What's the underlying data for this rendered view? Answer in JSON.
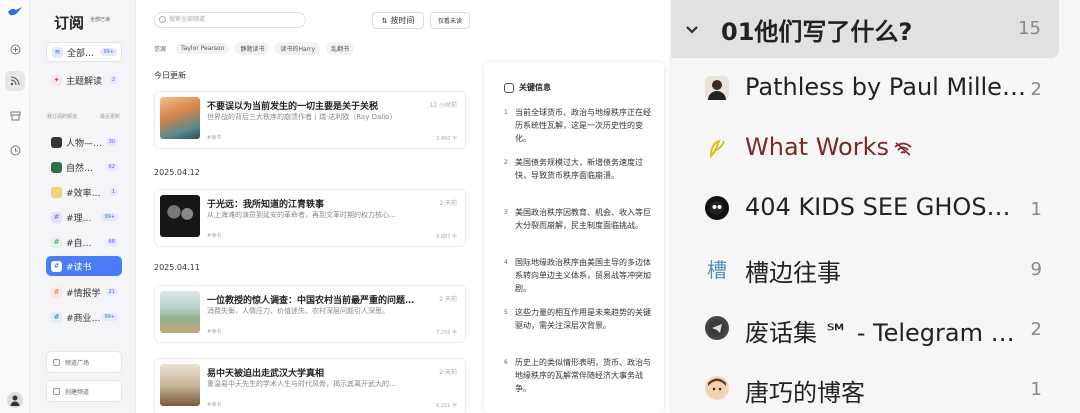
{
  "app": {
    "sidebar": {
      "title": "订阅",
      "subtitle": "全部已读",
      "items": [
        {
          "label": "全部…",
          "count": "99+"
        },
        {
          "label": "主题解读",
          "count": "2"
        }
      ],
      "section_left": "我订阅的频道",
      "section_right": "最近更新",
      "channels": [
        {
          "label": "人物—…",
          "count": "30"
        },
        {
          "label": "自然…",
          "count": "62"
        },
        {
          "label": "#效率…",
          "count": "1"
        },
        {
          "label": "#理…",
          "count": "99+"
        },
        {
          "label": "#自…",
          "count": "68"
        },
        {
          "label": "#读书",
          "count": ""
        },
        {
          "label": "#情报学",
          "count": "21"
        },
        {
          "label": "#商业…",
          "count": "99+"
        }
      ],
      "bottom_buttons": [
        "频道广场",
        "创建频道"
      ]
    },
    "main": {
      "search_placeholder": "搜索全部频道",
      "sort_label": "按时间",
      "unread_label": "仅看未读",
      "filter_label": "信源",
      "filters": [
        "Taylor Pearson",
        "静题读书",
        "读书的Harry",
        "乱翻书"
      ],
      "sections": [
        {
          "date": "今日更新",
          "cards": [
            {
              "title": "不要误以为当前发生的一切主要是关于关税",
              "desc": "世界战的背后三大秩序的崩溃作者丨瑞·达利欧（Ray Dalio）",
              "tag": "#读书",
              "time": "12 小时前",
              "words": "3,460 字"
            }
          ]
        },
        {
          "date": "2025.04.12",
          "cards": [
            {
              "title": "于光远：我所知道的江青轶事",
              "desc": "从上海滩的演员到延安的革命者，再到文革时期的权力核心…",
              "tag": "#读书",
              "time": "1 天前",
              "words": "9,887 字"
            }
          ]
        },
        {
          "date": "2025.04.11",
          "cards": [
            {
              "title": "一位教授的惊人调查：中国农村当前最严重的问题…",
              "desc": "消费失衡、人情压力、价值迷失、农村深层问题引人深思。",
              "tag": "#读书",
              "time": "2 天前",
              "words": "7,256 字"
            },
            {
              "title": "易中天被迫出走武汉大学真相",
              "desc": "重温易中天先生的学术人生与时代风骨，揭示其离开武大的…",
              "tag": "#读书",
              "time": "2 天前",
              "words": "6,221 字"
            }
          ]
        }
      ]
    },
    "panel": {
      "title": "关键信息",
      "points": [
        {
          "n": "1",
          "text": "当前全球货币、政治与地缘秩序正在经历系统性瓦解，这是一次历史性的变化。"
        },
        {
          "n": "2",
          "text": "美国债务规模过大，新增债务速度过快，导致货币秩序面临崩溃。"
        },
        {
          "n": "3",
          "text": "美国政治秩序因教育、机会、收入等巨大分裂而崩解，民主制度面临挑战。"
        },
        {
          "n": "4",
          "text": "国际地缘政治秩序由美国主导的多边体系转向单边主义体系，贸易战等冲突加剧。"
        },
        {
          "n": "5",
          "text": "这些力量的相互作用是未来趋势的关键驱动，需关注深层次背景。"
        },
        {
          "n": "6",
          "text": "历史上的类似情形表明，货币、政治与地缘秩序的瓦解常伴随经济大事务战争。"
        }
      ]
    },
    "right_list": {
      "folder_title": "01他们写了什么?",
      "folder_count": "15",
      "rows": [
        {
          "name": "Pathless by Paul Mille…",
          "count": "2",
          "icon": "person-avatar-icon",
          "color": "#222222"
        },
        {
          "name": "What Works",
          "count": "",
          "icon": "sprout-logo-icon",
          "color": "#7b2a2a"
        },
        {
          "name": "404 KIDS SEE GHOS…",
          "count": "1",
          "icon": "ghost-logo-icon",
          "color": "#222222"
        },
        {
          "name": "槽边往事",
          "count": "9",
          "icon": "cao-glyph-icon",
          "color": "#222222"
        },
        {
          "name": "废话集 ℠ - Telegram …",
          "count": "2",
          "icon": "telegram-logo-icon",
          "color": "#222222"
        },
        {
          "name": "唐巧的博客",
          "count": "1",
          "icon": "cartoon-avatar-icon",
          "color": "#222222"
        }
      ],
      "cao_glyph": "槽"
    }
  }
}
